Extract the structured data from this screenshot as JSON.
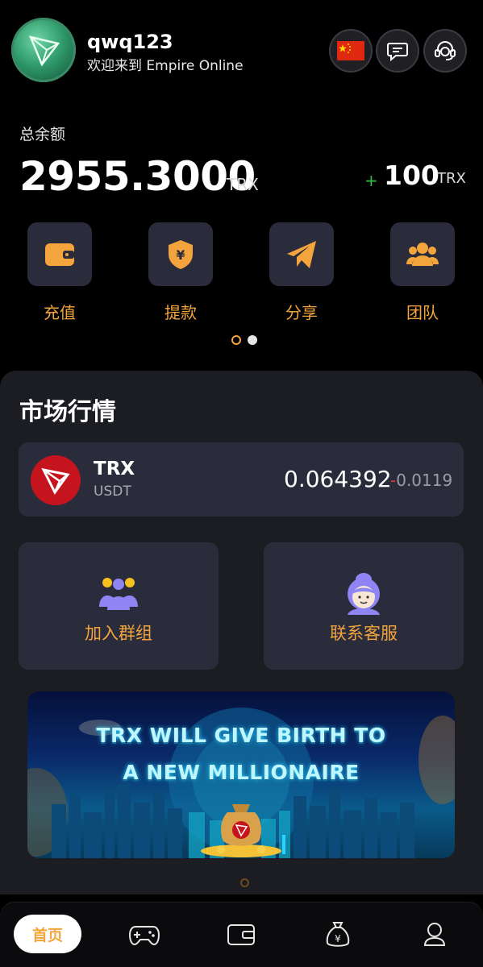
{
  "user": {
    "name": "qwq123",
    "welcome": "欢迎来到 Empire Online"
  },
  "header_icons": [
    "china-flag-icon",
    "chat-message-icon",
    "customer-service-headset-icon"
  ],
  "balance": {
    "label": "总余额",
    "amount": "2955.3000",
    "unit": "TRX",
    "bonus_sign": "+",
    "bonus_amount": "100",
    "bonus_unit": "TRX"
  },
  "actions": [
    {
      "label": "充值",
      "icon": "wallet-icon"
    },
    {
      "label": "提款",
      "icon": "shield-yen-icon"
    },
    {
      "label": "分享",
      "icon": "paper-plane-icon"
    },
    {
      "label": "团队",
      "icon": "team-icon"
    }
  ],
  "market": {
    "title": "市场行情",
    "coin": {
      "symbol": "TRX",
      "quote": "USDT",
      "price": "0.064392",
      "change_sign": "-",
      "change": "0.0119"
    }
  },
  "services": [
    {
      "label": "加入群组",
      "icon": "group-icon"
    },
    {
      "label": "联系客服",
      "icon": "customer-service-icon"
    }
  ],
  "banner": {
    "line1": "TRX WILL GIVE BIRTH  TO",
    "line2": "A NEW MILLIONAIRE"
  },
  "nav": {
    "home": "首页",
    "icons": [
      "gamepad-icon",
      "wallet-icon",
      "money-bag-icon",
      "profile-icon"
    ]
  },
  "colors": {
    "accent": "#f3a43c",
    "card": "#2a2c3b",
    "negative": "#e0353c",
    "positive": "#2fbf4a"
  }
}
